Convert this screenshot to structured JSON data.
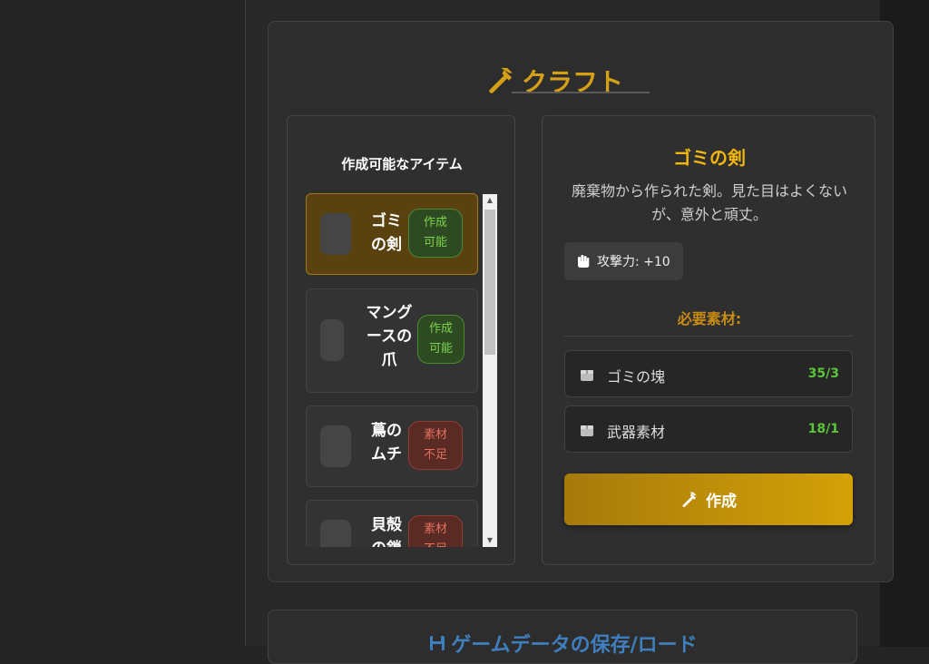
{
  "craft": {
    "title": "クラフト",
    "icon": "hammer-icon",
    "accent": "#d4a017"
  },
  "item_list": {
    "heading": "作成可能なアイテム",
    "items": [
      {
        "name_line1": "ゴミ",
        "name_line2": "の剣",
        "status_line1": "作成",
        "status_line2": "可能",
        "status": "ok",
        "selected": true
      },
      {
        "name_line1": "マング",
        "name_line2": "ースの",
        "name_line3": "爪",
        "status_line1": "作成",
        "status_line2": "可能",
        "status": "ok",
        "selected": false
      },
      {
        "name_line1": "蔦の",
        "name_line2": "ムチ",
        "status_line1": "素材",
        "status_line2": "不足",
        "status": "ng",
        "selected": false
      },
      {
        "name_line1": "貝殻",
        "name_line2": "の鎖",
        "status_line1": "素材",
        "status_line2": "不足",
        "status": "ng",
        "selected": false
      }
    ]
  },
  "detail": {
    "name": "ゴミの剣",
    "description": "廃棄物から作られた剣。見た目はよくないが、意外と頑丈。",
    "stat_icon": "fist-icon",
    "stat": "攻撃力: +10",
    "requirements_title": "必要素材:",
    "materials": [
      {
        "name": "ゴミの塊",
        "count": "35/3",
        "icon": "box-icon"
      },
      {
        "name": "武器素材",
        "count": "18/1",
        "icon": "box-icon"
      }
    ],
    "craft_button": "作成"
  },
  "save": {
    "title": "ゲームデータの保存/ロード",
    "icon": "floppy-icon",
    "accent": "#3f7fbf"
  }
}
